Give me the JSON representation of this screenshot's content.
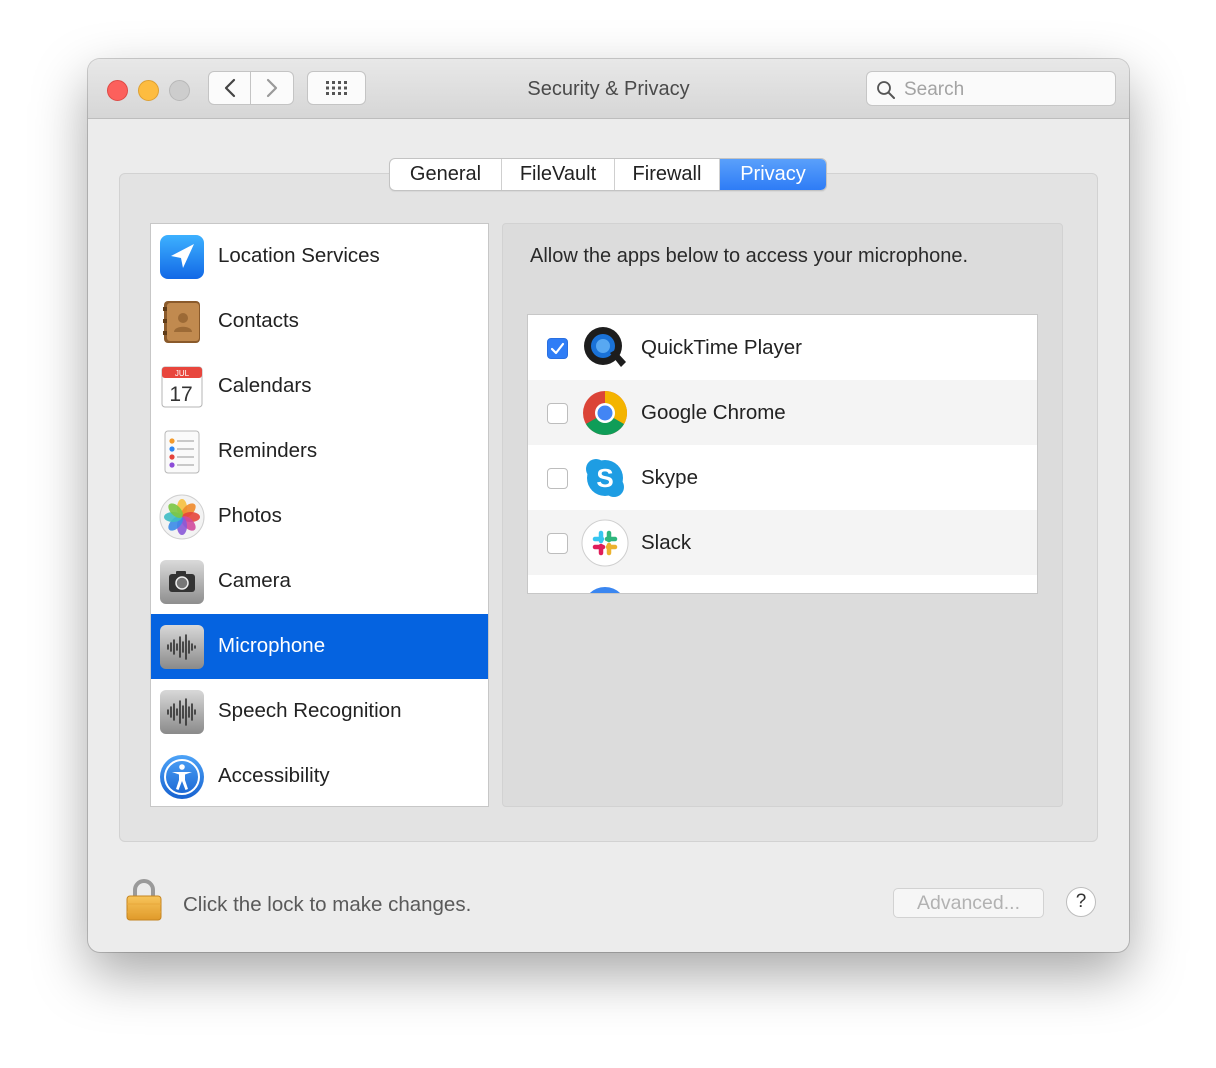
{
  "window": {
    "title": "Security & Privacy",
    "search_placeholder": "Search"
  },
  "tabs": [
    {
      "label": "General",
      "active": false
    },
    {
      "label": "FileVault",
      "active": false
    },
    {
      "label": "Firewall",
      "active": false
    },
    {
      "label": "Privacy",
      "active": true
    }
  ],
  "sidebar": {
    "items": [
      {
        "label": "Location Services",
        "icon": "location-services-icon",
        "selected": false
      },
      {
        "label": "Contacts",
        "icon": "contacts-icon",
        "selected": false
      },
      {
        "label": "Calendars",
        "icon": "calendars-icon",
        "selected": false,
        "icon_month": "JUL",
        "icon_day": "17"
      },
      {
        "label": "Reminders",
        "icon": "reminders-icon",
        "selected": false
      },
      {
        "label": "Photos",
        "icon": "photos-icon",
        "selected": false
      },
      {
        "label": "Camera",
        "icon": "camera-icon",
        "selected": false
      },
      {
        "label": "Microphone",
        "icon": "microphone-icon",
        "selected": true
      },
      {
        "label": "Speech Recognition",
        "icon": "speech-recognition-icon",
        "selected": false
      },
      {
        "label": "Accessibility",
        "icon": "accessibility-icon",
        "selected": false
      }
    ]
  },
  "main": {
    "description": "Allow the apps below to access your microphone.",
    "apps": [
      {
        "label": "QuickTime Player",
        "icon": "quicktime-icon",
        "checked": true
      },
      {
        "label": "Google Chrome",
        "icon": "chrome-icon",
        "checked": false
      },
      {
        "label": "Skype",
        "icon": "skype-icon",
        "checked": false
      },
      {
        "label": "Slack",
        "icon": "slack-icon",
        "checked": false
      }
    ]
  },
  "footer": {
    "lock_text": "Click the lock to make changes.",
    "advanced_label": "Advanced...",
    "help_label": "?"
  },
  "colors": {
    "selection": "#0563e0",
    "accent": "#2f7df6"
  }
}
